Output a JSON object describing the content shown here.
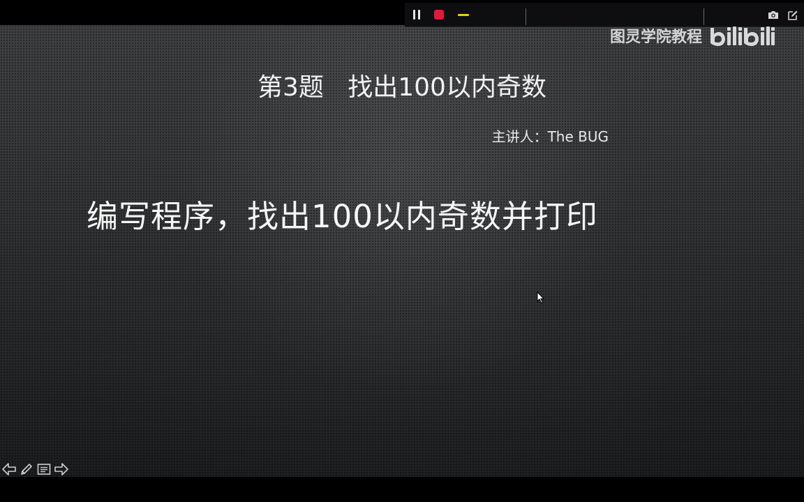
{
  "recorder": {
    "pause": "pause-icon",
    "stop": "stop-icon",
    "minimize": "minimize-icon",
    "camera": "camera-icon",
    "edit": "edit-icon",
    "colors": {
      "stop": "#e5173f",
      "minimize": "#f5c518"
    }
  },
  "watermark": {
    "text": "图灵学院教程",
    "logo": "bilibili"
  },
  "slide": {
    "title": "第3题   找出100以内奇数",
    "presenter": "主讲人：The BUG",
    "body": "编写程序，找出100以内奇数并打印"
  },
  "nav": {
    "items": [
      "previous-arrow-icon",
      "pen-icon",
      "menu-icon",
      "next-arrow-icon"
    ]
  }
}
